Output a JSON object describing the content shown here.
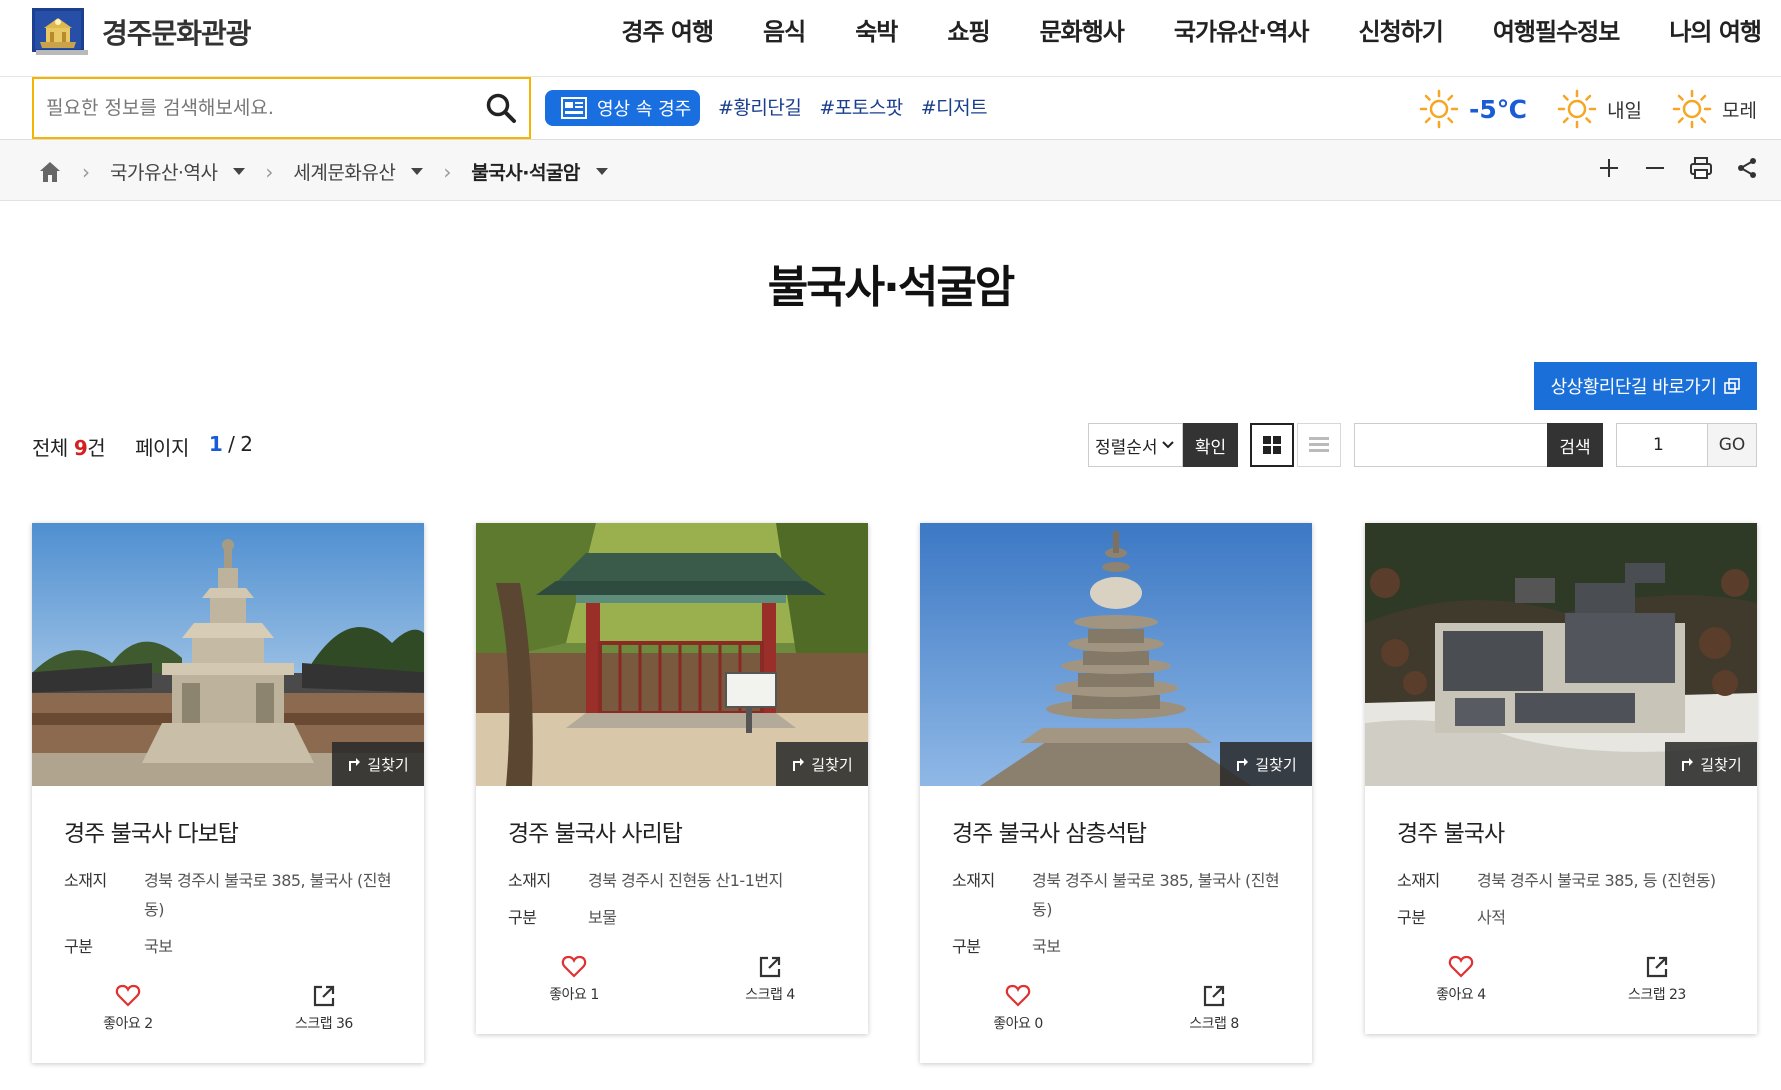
{
  "header": {
    "logo_text": "경주문화관광",
    "nav": [
      "경주 여행",
      "음식",
      "숙박",
      "쇼핑",
      "문화행사",
      "국가유산·역사",
      "신청하기",
      "여행필수정보",
      "나의 여행"
    ]
  },
  "search": {
    "placeholder": "필요한 정보를 검색해보세요.",
    "video_button": "영상 속 경주",
    "hashtags": [
      "#황리단길",
      "#포토스팟",
      "#디저트"
    ]
  },
  "weather": {
    "today_temp": "-5℃",
    "tomorrow_label": "내일",
    "after_label": "모레",
    "icon": "sun-icon",
    "sun_color": "#f5a623"
  },
  "breadcrumb": {
    "items": [
      "국가유산·역사",
      "세계문화유산",
      "불국사·석굴암"
    ]
  },
  "page": {
    "title": "불국사·석굴암",
    "goto_button": "상상황리단길 바로가기",
    "total_label": "전체",
    "total_count": "9",
    "total_unit": "건",
    "page_label": "페이지",
    "page_current": "1",
    "page_sep": "/",
    "page_total": "2"
  },
  "toolbar": {
    "sort_label": "정렬순서",
    "confirm_label": "확인",
    "search_label": "검색",
    "page_input": "1",
    "go_label": "GO"
  },
  "cards": [
    {
      "title": "경주 불국사 다보탑",
      "location_label": "소재지",
      "location": "경북 경주시 불국로 385, 불국사 (진현동)",
      "type_label": "구분",
      "type": "국보",
      "route_label": "길찾기",
      "like_label": "좋아요 2",
      "scrap_label": "스크랩 36"
    },
    {
      "title": "경주 불국사 사리탑",
      "location_label": "소재지",
      "location": "경북 경주시 진현동 산1-1번지",
      "type_label": "구분",
      "type": "보물",
      "route_label": "길찾기",
      "like_label": "좋아요 1",
      "scrap_label": "스크랩 4"
    },
    {
      "title": "경주 불국사 삼층석탑",
      "location_label": "소재지",
      "location": "경북 경주시 불국로 385, 불국사 (진현동)",
      "type_label": "구분",
      "type": "국보",
      "route_label": "길찾기",
      "like_label": "좋아요 0",
      "scrap_label": "스크랩 8"
    },
    {
      "title": "경주 불국사",
      "location_label": "소재지",
      "location": "경북 경주시 불국로 385, 등 (진현동)",
      "type_label": "구분",
      "type": "사적",
      "route_label": "길찾기",
      "like_label": "좋아요 4",
      "scrap_label": "스크랩 23"
    }
  ],
  "colors": {
    "brand_blue": "#1a6fd8",
    "search_border": "#f5b400",
    "count_red": "#d42020",
    "like_red": "#e03030"
  }
}
